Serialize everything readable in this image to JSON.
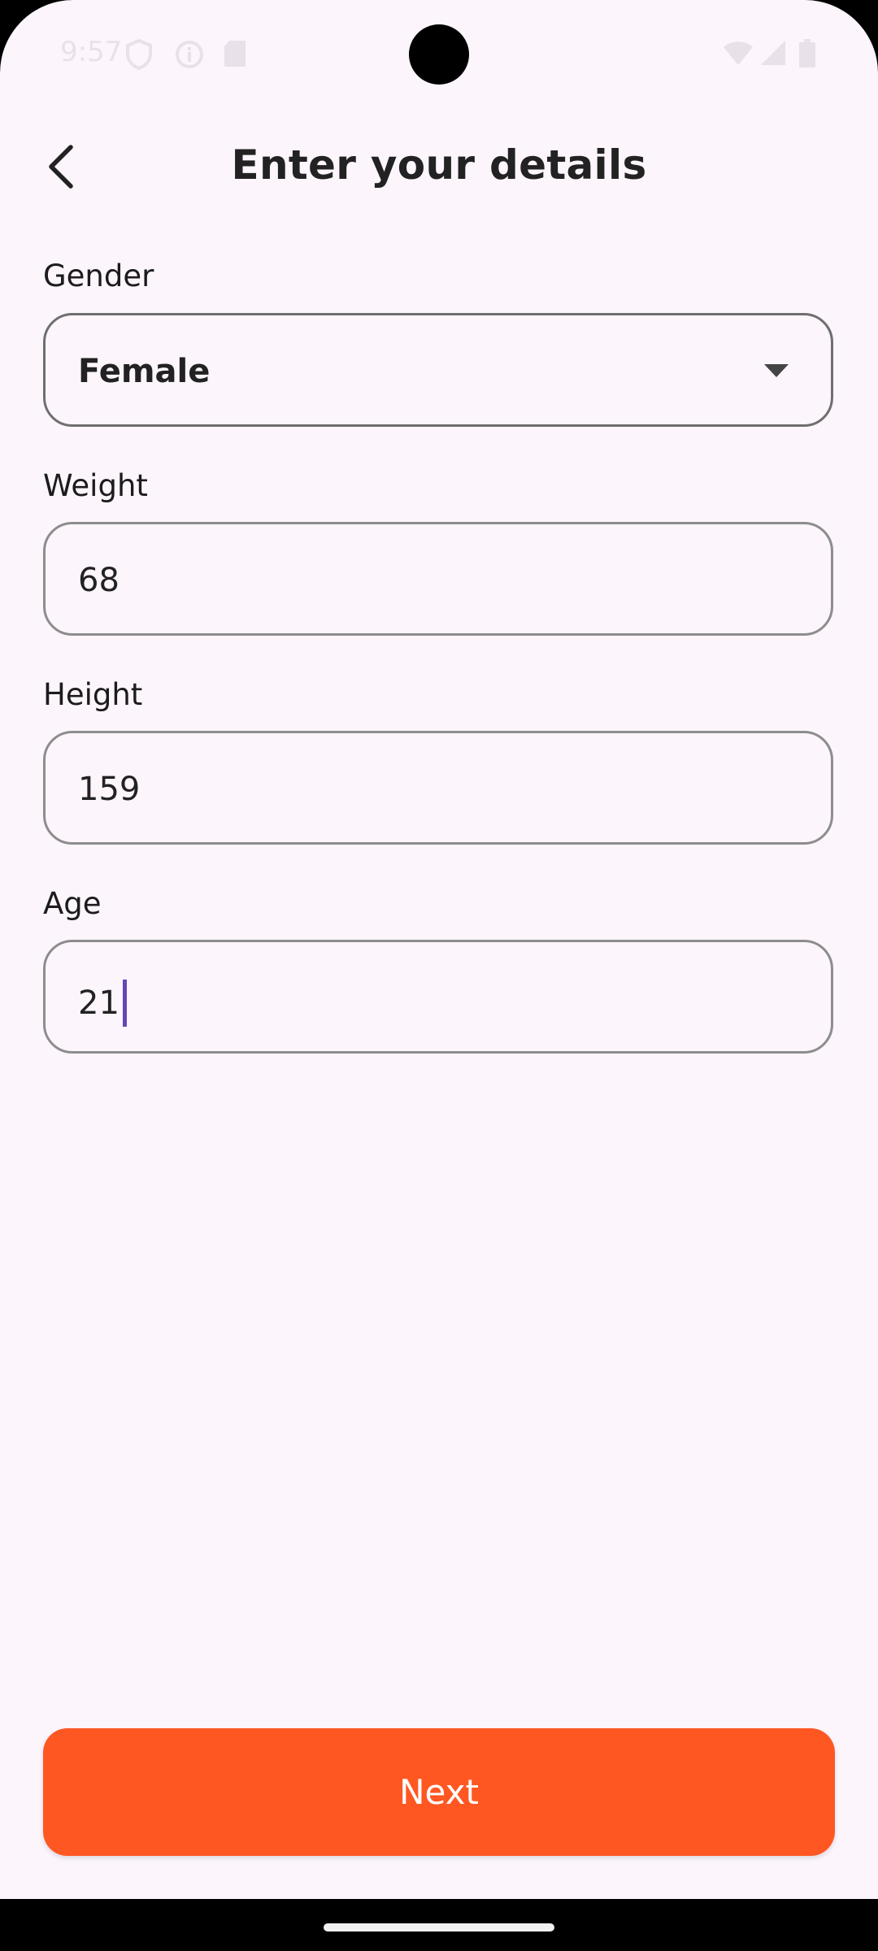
{
  "status_bar": {
    "time": "9:57",
    "icons": [
      "shield-icon",
      "info-icon",
      "sd-card-icon",
      "wifi-icon",
      "cell-signal-icon",
      "battery-icon"
    ]
  },
  "header": {
    "title": "Enter your details"
  },
  "form": {
    "gender": {
      "label": "Gender",
      "value": "Female"
    },
    "weight": {
      "label": "Weight",
      "value": "68"
    },
    "height": {
      "label": "Height",
      "value": "159"
    },
    "age": {
      "label": "Age",
      "value": "21"
    }
  },
  "actions": {
    "next_label": "Next"
  },
  "colors": {
    "background": "#fcf5fc",
    "accent": "#ff5722",
    "caret": "#6446b4"
  }
}
